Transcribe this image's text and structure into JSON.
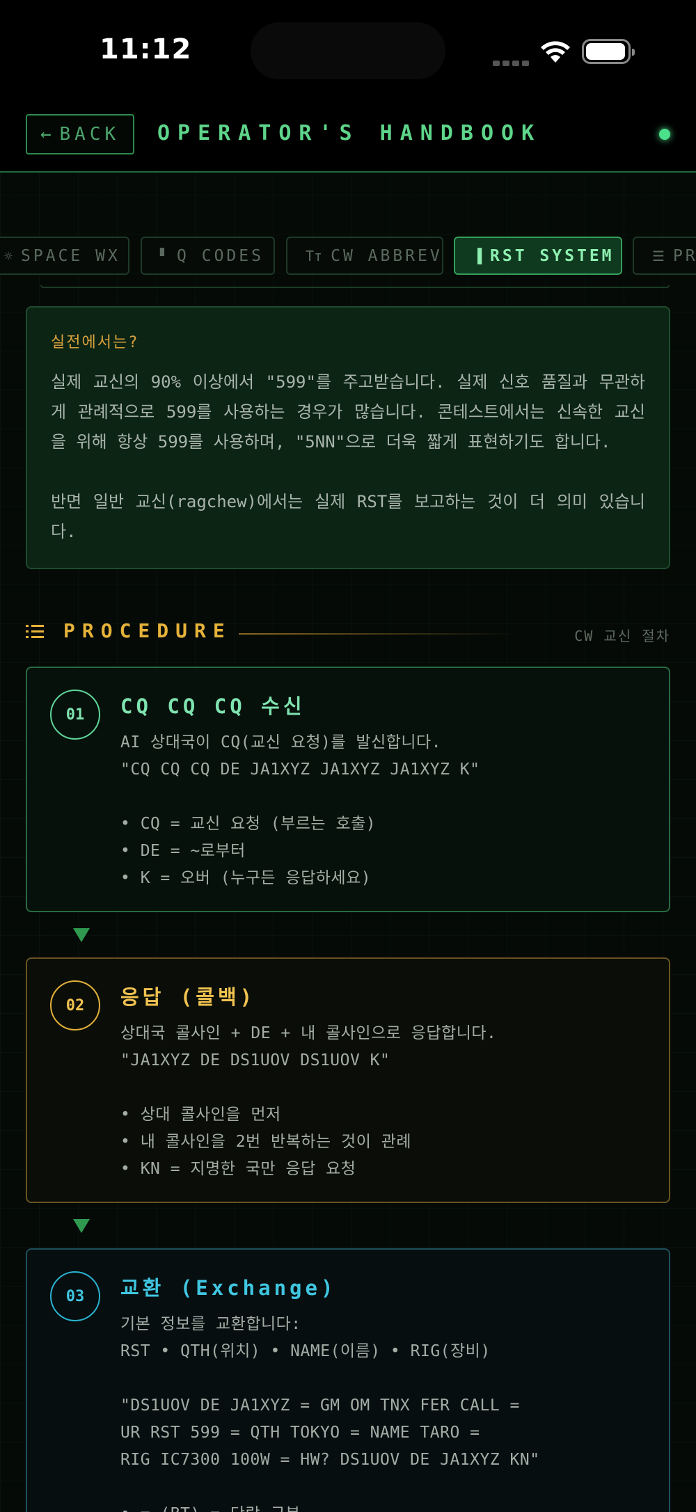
{
  "status_bar": {
    "time": "11:12"
  },
  "header": {
    "back_label": "BACK",
    "title": "OPERATOR'S HANDBOOK"
  },
  "tabs": [
    {
      "label": "SPACE WX",
      "icon": "sun-icon"
    },
    {
      "label": "Q CODES",
      "icon": "book-icon"
    },
    {
      "label": "CW ABBREV",
      "icon": "text-size-icon"
    },
    {
      "label": "RST SYSTEM",
      "icon": "bar-chart-icon",
      "active": true
    },
    {
      "label": "PR",
      "icon": "list-icon"
    }
  ],
  "tip": {
    "title": "실전에서는?",
    "para1": "실제 교신의 90% 이상에서 \"599\"를 주고받습니다. 실제 신호 품질과 무관하게 관례적으로 599를 사용하는 경우가 많습니다. 콘테스트에서는 신속한 교신을 위해 항상 599를 사용하며, \"5NN\"으로 더욱 짧게 표현하기도 합니다.",
    "para2": "반면 일반 교신(ragchew)에서는 실제 RST를 보고하는 것이 더 의미 있습니다."
  },
  "procedure": {
    "title": "PROCEDURE",
    "subtitle": "CW 교신 절차",
    "steps": [
      {
        "num": "01",
        "title": "CQ CQ CQ 수신",
        "body": "AI 상대국이 CQ(교신 요청)를 발신합니다.\n\"CQ CQ CQ DE JA1XYZ JA1XYZ JA1XYZ K\"\n\n• CQ = 교신 요청 (부르는 호출)\n• DE = ~로부터\n• K = 오버 (누구든 응답하세요)"
      },
      {
        "num": "02",
        "title": "응답 (콜백)",
        "body": "상대국 콜사인 + DE + 내 콜사인으로 응답합니다.\n\"JA1XYZ DE DS1UOV DS1UOV K\"\n\n• 상대 콜사인을 먼저\n• 내 콜사인을 2번 반복하는 것이 관례\n• KN = 지명한 국만 응답 요청"
      },
      {
        "num": "03",
        "title": "교환 (Exchange)",
        "body": "기본 정보를 교환합니다:\nRST • QTH(위치) • NAME(이름) • RIG(장비)\n\n\"DS1UOV DE JA1XYZ = GM OM TNX FER CALL =\nUR RST 599 = QTH TOKYO = NAME TARO =\nRIG IC7300 100W = HW? DS1UOV DE JA1XYZ KN\"\n\n• = (BT) = 단락 구분"
      }
    ]
  },
  "colors": {
    "accent_green": "#5ed58a",
    "accent_amber": "#e6b23a",
    "accent_cyan": "#40c6e0"
  }
}
